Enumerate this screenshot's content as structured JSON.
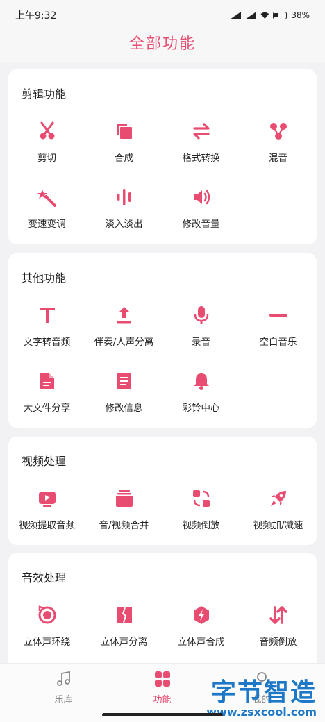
{
  "status_bar": {
    "time": "上午9:32",
    "battery": "38%"
  },
  "header": {
    "title": "全部功能"
  },
  "sections": [
    {
      "title": "剪辑功能",
      "items": [
        {
          "label": "剪切",
          "icon": "scissors-icon"
        },
        {
          "label": "合成",
          "icon": "merge-layers-icon"
        },
        {
          "label": "格式转换",
          "icon": "convert-arrows-icon"
        },
        {
          "label": "混音",
          "icon": "mix-nodes-icon"
        },
        {
          "label": "变速变调",
          "icon": "magic-wand-icon"
        },
        {
          "label": "淡入淡出",
          "icon": "waveform-icon"
        },
        {
          "label": "修改音量",
          "icon": "volume-icon"
        }
      ]
    },
    {
      "title": "其他功能",
      "items": [
        {
          "label": "文字转音频",
          "icon": "text-icon"
        },
        {
          "label": "伴奏/人声分离",
          "icon": "upload-icon"
        },
        {
          "label": "录音",
          "icon": "microphone-icon"
        },
        {
          "label": "空白音乐",
          "icon": "minus-bar-icon"
        },
        {
          "label": "大文件分享",
          "icon": "file-icon"
        },
        {
          "label": "修改信息",
          "icon": "document-edit-icon"
        },
        {
          "label": "彩铃中心",
          "icon": "bell-icon"
        }
      ]
    },
    {
      "title": "视频处理",
      "items": [
        {
          "label": "视频提取音频",
          "icon": "video-play-icon"
        },
        {
          "label": "音/视频合并",
          "icon": "stack-icon"
        },
        {
          "label": "视频倒放",
          "icon": "reverse-squares-icon"
        },
        {
          "label": "视频加/减速",
          "icon": "rocket-icon"
        }
      ]
    },
    {
      "title": "音效处理",
      "items": [
        {
          "label": "立体声环绕",
          "icon": "surround-icon"
        },
        {
          "label": "立体声分离",
          "icon": "split-icon"
        },
        {
          "label": "立体声合成",
          "icon": "bolt-hexagon-icon"
        },
        {
          "label": "音频倒放",
          "icon": "reverse-arrows-icon"
        }
      ]
    }
  ],
  "tabbar": [
    {
      "label": "乐库",
      "icon": "music-note-icon",
      "active": false
    },
    {
      "label": "功能",
      "icon": "apps-grid-icon",
      "active": true
    },
    {
      "label": "我的",
      "icon": "profile-icon",
      "active": false
    }
  ],
  "watermark": {
    "title": "字节智造",
    "url": "www.zsxcool.com"
  },
  "colors": {
    "accent": "#e84c70",
    "watermark": "#1e78c8"
  }
}
